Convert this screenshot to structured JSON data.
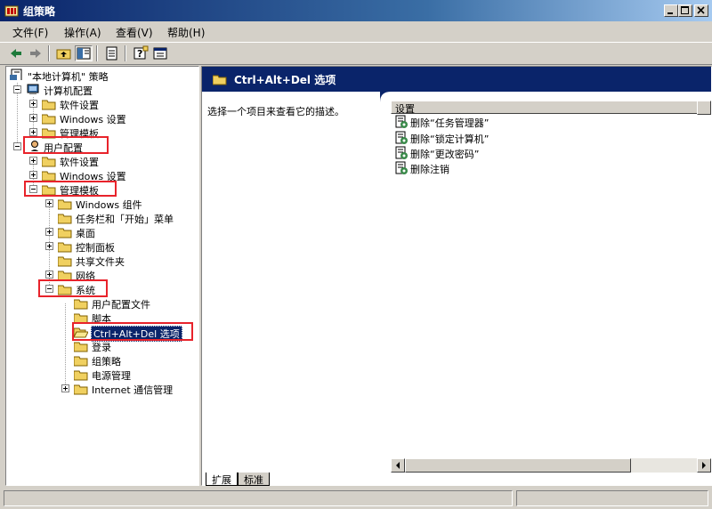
{
  "window": {
    "title": "组策略"
  },
  "menu": [
    {
      "label": "文件(F)"
    },
    {
      "label": "操作(A)"
    },
    {
      "label": "查看(V)"
    },
    {
      "label": "帮助(H)"
    }
  ],
  "toolbar": {
    "buttons": [
      "back-arrow-icon",
      "forward-arrow-icon",
      "up-folder-icon",
      "show-hide-tree-icon",
      "export-list-icon",
      "help-icon",
      "properties-icon"
    ]
  },
  "tree": {
    "root": "\"本地计算机\" 策略",
    "computer_config": "计算机配置",
    "cc_software": "软件设置",
    "cc_windows": "Windows 设置",
    "cc_admin": "管理模板",
    "user_config": "用户配置",
    "uc_software": "软件设置",
    "uc_windows": "Windows 设置",
    "uc_admin": "管理模板",
    "windows_components": "Windows 组件",
    "taskbar": "任务栏和「开始」菜单",
    "desktop": "桌面",
    "control_panel": "控制面板",
    "shared_folders": "共享文件夹",
    "network": "网络",
    "system": "系统",
    "user_profiles": "用户配置文件",
    "scripts": "脚本",
    "cad_options": "Ctrl+Alt+Del 选项",
    "logon": "登录",
    "group_policy": "组策略",
    "power_mgmt": "电源管理",
    "internet_comm": "Internet 通信管理"
  },
  "right": {
    "header_title": "Ctrl+Alt+Del 选项",
    "description": "选择一个项目来查看它的描述。",
    "column_header": "设置",
    "items": [
      "删除“任务管理器”",
      "删除“锁定计算机”",
      "删除“更改密码”",
      "删除注销"
    ],
    "tabs": [
      {
        "label": "扩展"
      },
      {
        "label": "标准"
      }
    ]
  },
  "colors": {
    "highlight_box": "#e8232b",
    "titlebar": "#0a246a",
    "selection": "#0a246a"
  }
}
